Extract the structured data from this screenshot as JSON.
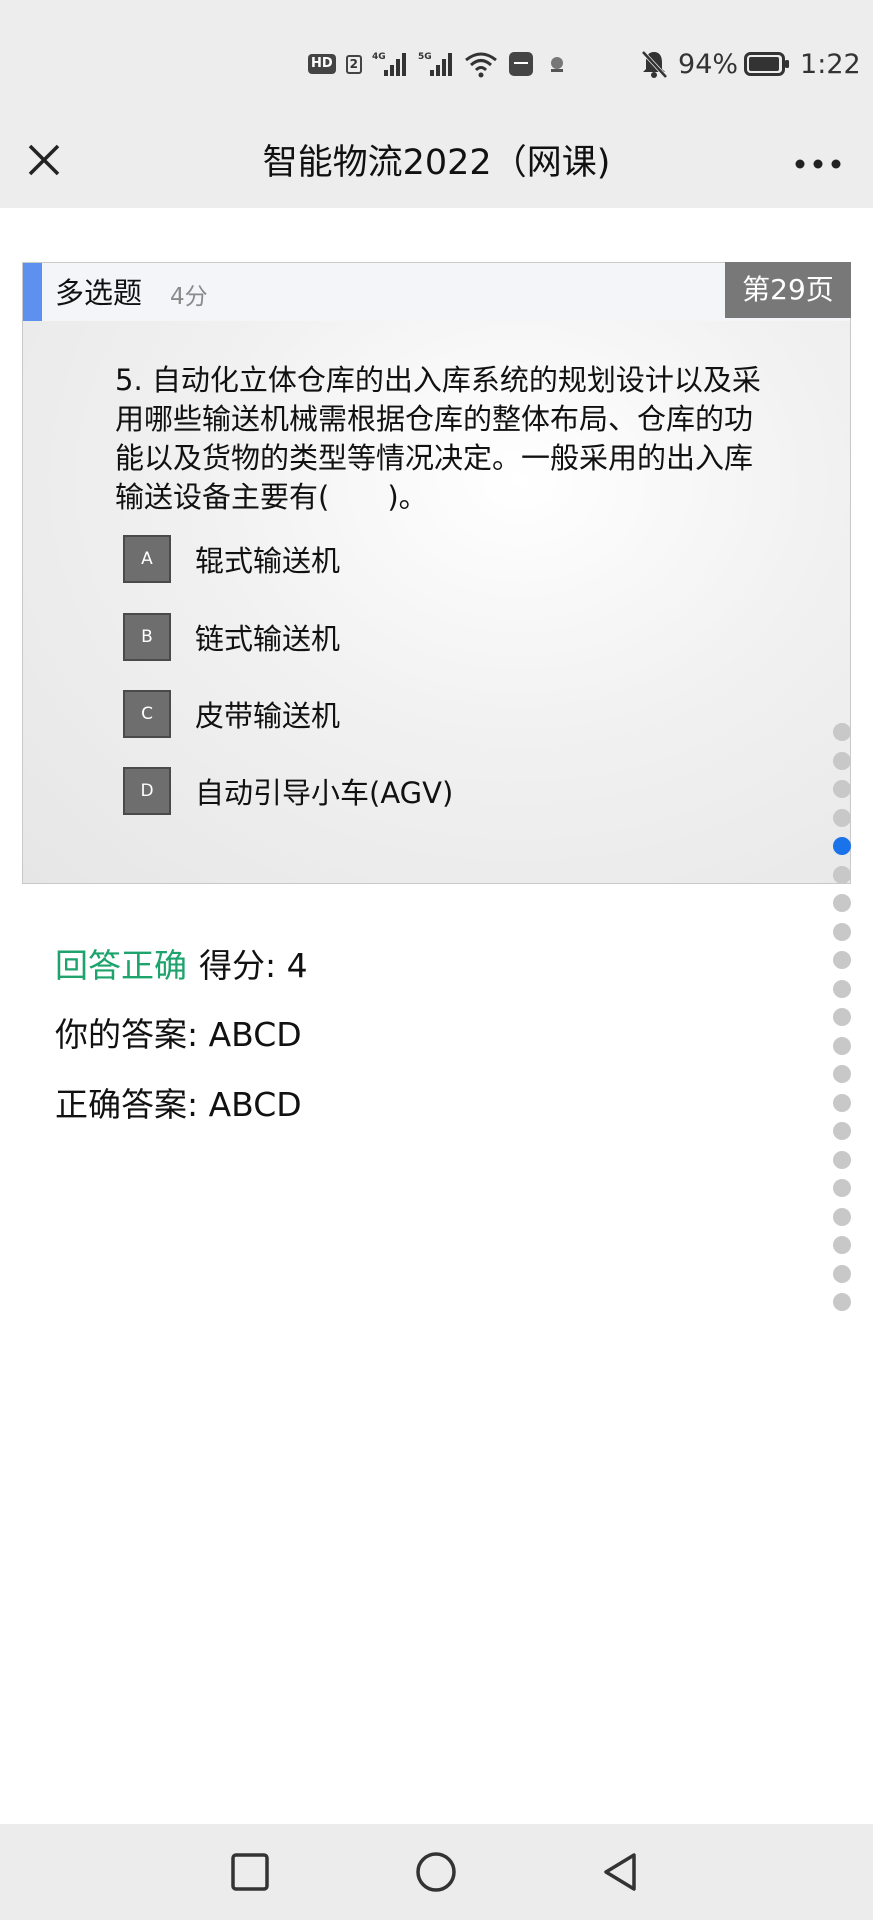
{
  "status_bar": {
    "hd": "HD",
    "sim1": "2",
    "net1": "4G",
    "net2": "5G",
    "battery_text": "94%",
    "time": "1:22",
    "icons": [
      "hd-icon",
      "signal-4g-icon",
      "signal-5g-icon",
      "wifi-icon",
      "huawei-app-icon",
      "notification-icon",
      "mute-bell-icon",
      "battery-icon"
    ]
  },
  "header": {
    "title": "智能物流2022（网课)",
    "close_icon": "close-icon",
    "more_icon": "more-icon"
  },
  "card": {
    "type_label": "多选题",
    "score_label": "4分",
    "page_badge": "第29页",
    "question": "5. 自动化立体仓库的出入库系统的规划设计以及采用哪些输送机械需根据仓库的整体布局、仓库的功能以及货物的类型等情况决定。一般采用的出入库输送设备主要有(　　)。",
    "options": [
      {
        "key": "A",
        "text": "辊式输送机"
      },
      {
        "key": "B",
        "text": "链式输送机"
      },
      {
        "key": "C",
        "text": "皮带输送机"
      },
      {
        "key": "D",
        "text": "自动引导小车(AGV)"
      }
    ]
  },
  "result": {
    "status": "回答正确",
    "score": "得分: 4",
    "your_answer": "你的答案: ABCD",
    "correct_answer": "正确答案: ABCD"
  },
  "pager": {
    "total_dots": 21,
    "active_index": 4,
    "active_color": "#1a73e8"
  },
  "system_nav": {
    "icons": [
      "recent-apps-icon",
      "home-icon",
      "back-icon"
    ]
  }
}
